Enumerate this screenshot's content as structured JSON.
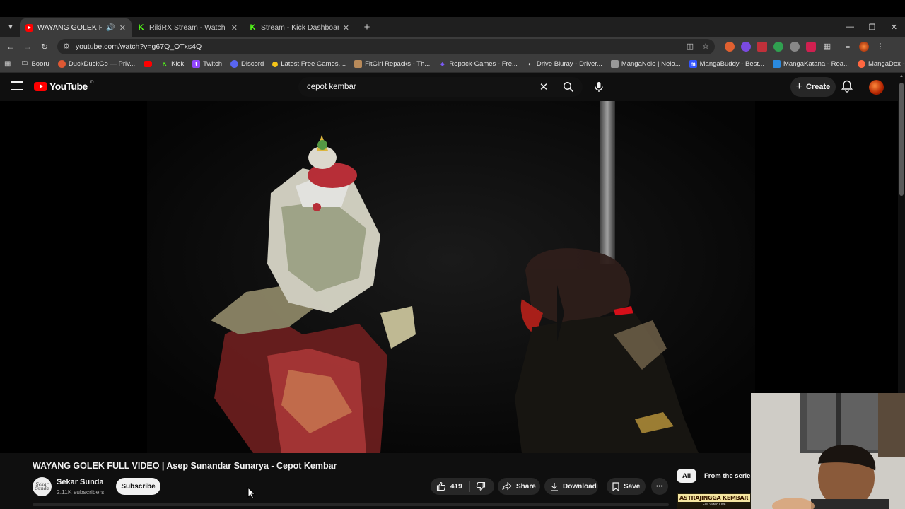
{
  "browser": {
    "tabs": [
      {
        "title": "WAYANG GOLEK FULL VIDEO",
        "favicon": "youtube",
        "active": true
      },
      {
        "title": "RikiRX Stream - Watch Live on",
        "favicon": "kick",
        "active": false
      },
      {
        "title": "Stream - Kick Dashboard",
        "favicon": "kick",
        "active": false
      }
    ],
    "url": "youtube.com/watch?v=g67Q_OTxs4Q",
    "bookmarks": [
      {
        "label": "Booru",
        "icon": "folder-icon",
        "color": "#cccccc"
      },
      {
        "label": "DuckDuckGo — Priv...",
        "icon": "duckduckgo-icon",
        "color": "#de5833"
      },
      {
        "label": "",
        "icon": "youtube-icon",
        "color": "#ff0000"
      },
      {
        "label": "Kick",
        "icon": "kick-icon",
        "color": "#53fc18"
      },
      {
        "label": "Twitch",
        "icon": "twitch-icon",
        "color": "#9146ff"
      },
      {
        "label": "Discord",
        "icon": "discord-icon",
        "color": "#5865f2"
      },
      {
        "label": "Latest Free Games,...",
        "icon": "game-icon",
        "color": "#f5c518"
      },
      {
        "label": "FitGirl Repacks - Th...",
        "icon": "fitgirl-icon",
        "color": "#b88a5a"
      },
      {
        "label": "Repack-Games - Fre...",
        "icon": "repack-icon",
        "color": "#7a5af5"
      },
      {
        "label": "Drive Bluray - Driver...",
        "icon": "drive-icon",
        "color": "#dddddd"
      },
      {
        "label": "MangaNelo | Nelo...",
        "icon": "manganelo-icon",
        "color": "#999999"
      },
      {
        "label": "MangaBuddy - Best...",
        "icon": "mangabuddy-icon",
        "color": "#3355ff"
      },
      {
        "label": "MangaKatana - Rea...",
        "icon": "mangakatana-icon",
        "color": "#2a8adf"
      },
      {
        "label": "MangaDex - High q...",
        "icon": "mangadex-icon",
        "color": "#ff6740"
      }
    ]
  },
  "youtube": {
    "logo_text": "YouTube",
    "region": "ID",
    "search_query": "cepot kembar",
    "create_label": "Create"
  },
  "video": {
    "title": "WAYANG GOLEK FULL VIDEO | Asep Sunandar Sunarya - Cepot Kembar",
    "channel": "Sekar Sunda",
    "channel_avatar_text": "Sekar Sunda",
    "subscribers": "2.11K subscribers",
    "subscribe_label": "Subscribe",
    "likes": "419",
    "share_label": "Share",
    "download_label": "Download",
    "save_label": "Save"
  },
  "recommendations": {
    "chips": [
      "All",
      "From the series"
    ],
    "thumb_title": "ASTRAJINGGA KEMBAR",
    "thumb_subtitle": "Full Video Live"
  },
  "colors": {
    "brand_red": "#ff0000",
    "kick_green": "#53fc18",
    "page_bg": "#0f0f0f"
  }
}
